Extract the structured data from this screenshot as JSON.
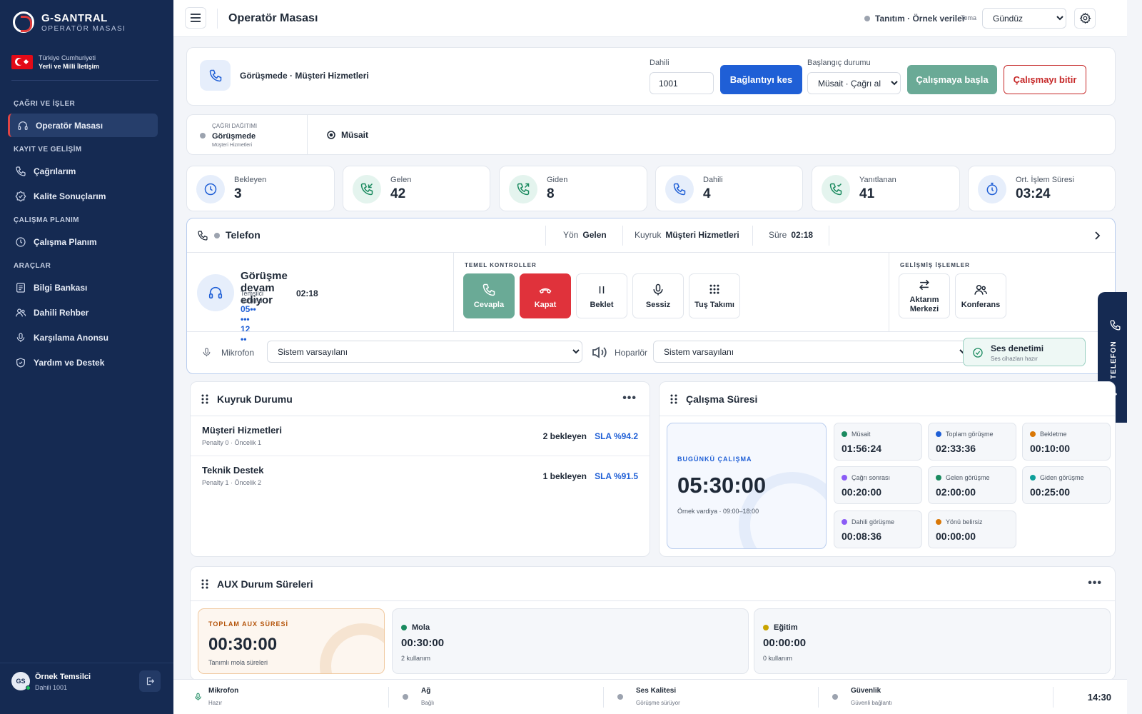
{
  "sidebar": {
    "brand_title": "G-SANTRAL",
    "brand_subtitle": "OPERATÖR MASASI",
    "flag_line1": "Türkiye Cumhuriyeti",
    "flag_line2": "Yerli ve Milli İletişim",
    "sections": [
      {
        "title": "ÇAĞRI VE İŞLER",
        "items": [
          {
            "label": "Operatör Masası",
            "icon": "headset-icon",
            "active": true
          }
        ]
      },
      {
        "title": "KAYIT VE GELİŞİM",
        "items": [
          {
            "label": "Çağrılarım",
            "icon": "phone-icon"
          },
          {
            "label": "Kalite Sonuçlarım",
            "icon": "badge-check-icon"
          }
        ]
      },
      {
        "title": "ÇALIŞMA PLANIM",
        "items": [
          {
            "label": "Çalışma Planım",
            "icon": "clock-icon"
          }
        ]
      },
      {
        "title": "ARAÇLAR",
        "items": [
          {
            "label": "Bilgi Bankası",
            "icon": "list-icon"
          },
          {
            "label": "Dahili Rehber",
            "icon": "users-icon"
          },
          {
            "label": "Karşılama Anonsu",
            "icon": "microphone-icon"
          },
          {
            "label": "Yardım ve Destek",
            "icon": "shield-icon"
          }
        ]
      }
    ],
    "user": {
      "initials": "GS",
      "name": "Örnek Temsilci",
      "extension": "Dahili 1001"
    }
  },
  "topbar": {
    "title": "Operatör Masası",
    "demo_label": "Tanıtım · Örnek veriler",
    "theme_label": "Tema",
    "theme_value": "Gündüz"
  },
  "connection": {
    "status": "Görüşmede · Müşteri Hizmetleri",
    "extension_label": "Dahili",
    "extension_value": "1001",
    "disconnect_label": "Bağlantıyı kes",
    "start_state_label": "Başlangıç durumu",
    "start_state_value": "Müsait · Çağrı al",
    "start_work_label": "Çalışmaya başla",
    "end_work_label": "Çalışmayı bitir"
  },
  "distribution": {
    "caption": "ÇAĞRI DAĞITIMI",
    "state": "Görüşmede",
    "queue": "Müşteri Hizmetleri",
    "availability": "Müsait"
  },
  "stats": [
    {
      "label": "Bekleyen",
      "value": "3",
      "icon": "clock-icon",
      "tone": "blue"
    },
    {
      "label": "Gelen",
      "value": "42",
      "icon": "phone-incoming-icon",
      "tone": "green"
    },
    {
      "label": "Giden",
      "value": "8",
      "icon": "phone-outgoing-icon",
      "tone": "green"
    },
    {
      "label": "Dahili",
      "value": "4",
      "icon": "phone-icon",
      "tone": "blue"
    },
    {
      "label": "Yanıtlanan",
      "value": "41",
      "icon": "phone-answered-icon",
      "tone": "green"
    },
    {
      "label": "Ort. İşlem Süresi",
      "value": "03:24",
      "icon": "stopwatch-icon",
      "tone": "blue"
    }
  ],
  "phone": {
    "title": "Telefon",
    "direction_label": "Yön",
    "direction_value": "Gelen",
    "queue_label": "Kuyruk",
    "queue_value": "Müşteri Hizmetleri",
    "duration_label": "Süre",
    "duration_value": "02:18",
    "call_title": "Görüşme devam ediyor",
    "agent_state_label": "Temsilci durumu",
    "agent_state_time": "02:18",
    "caller_number": "05•• ••• 12 ••",
    "basic_caption": "TEMEL KONTROLLER",
    "advanced_caption": "GELİŞMİŞ İŞLEMLER",
    "controls": {
      "answer": "Cevapla",
      "hangup": "Kapat",
      "hold": "Beklet",
      "mute": "Sessiz",
      "keypad": "Tuş Takımı",
      "transfer": "Aktarım Merkezi",
      "conference": "Konferans"
    },
    "mic_label": "Mikrofon",
    "mic_value": "Sistem varsayılanı",
    "speaker_label": "Hoparlör",
    "speaker_value": "Sistem varsayılanı",
    "audio_check_title": "Ses denetimi",
    "audio_check_sub": "Ses cihazları hazır",
    "side_tab_label": "TELEFON"
  },
  "queues": {
    "title": "Kuyruk Durumu",
    "rows": [
      {
        "name": "Müşteri Hizmetleri",
        "meta": "Penalty 0 · Öncelik 1",
        "waiting": "2 bekleyen",
        "sla": "SLA %94.2"
      },
      {
        "name": "Teknik Destek",
        "meta": "Penalty 1 · Öncelik 2",
        "waiting": "1 bekleyen",
        "sla": "SLA %91.5"
      }
    ]
  },
  "worktime": {
    "title": "Çalışma Süresi",
    "today_caption": "BUGÜNKÜ ÇALIŞMA",
    "today_value": "05:30:00",
    "shift": "Örnek vardiya · 09:00–18:00",
    "metrics": [
      {
        "label": "Müsait",
        "value": "01:56:24",
        "color": "#1a8a5f"
      },
      {
        "label": "Toplam görüşme",
        "value": "02:33:36",
        "color": "#1f5fd6"
      },
      {
        "label": "Bekletme",
        "value": "00:10:00",
        "color": "#d97706"
      },
      {
        "label": "Çağrı sonrası",
        "value": "00:20:00",
        "color": "#8b5cf6"
      },
      {
        "label": "Gelen görüşme",
        "value": "02:00:00",
        "color": "#1a8a5f"
      },
      {
        "label": "Giden görüşme",
        "value": "00:25:00",
        "color": "#0e9f9a"
      },
      {
        "label": "Dahili görüşme",
        "value": "00:08:36",
        "color": "#8b5cf6"
      },
      {
        "label": "Yönü belirsiz",
        "value": "00:00:00",
        "color": "#d97706"
      }
    ]
  },
  "aux": {
    "title": "AUX Durum Süreleri",
    "total_caption": "TOPLAM AUX SÜRESİ",
    "total_value": "00:30:00",
    "total_sub": "Tanımlı mola süreleri",
    "items": [
      {
        "label": "Mola",
        "value": "00:30:00",
        "users": "2 kullanım",
        "color": "#1a8a5f"
      },
      {
        "label": "Eğitim",
        "value": "00:00:00",
        "users": "0 kullanım",
        "color": "#c9a400"
      }
    ]
  },
  "statusbar": {
    "items": [
      {
        "title": "Mikrofon",
        "sub": "Hazır"
      },
      {
        "title": "Ağ",
        "sub": "Bağlı"
      },
      {
        "title": "Ses Kalitesi",
        "sub": "Görüşme sürüyor"
      },
      {
        "title": "Güvenlik",
        "sub": "Güvenli bağlantı"
      }
    ],
    "time": "14:30"
  }
}
